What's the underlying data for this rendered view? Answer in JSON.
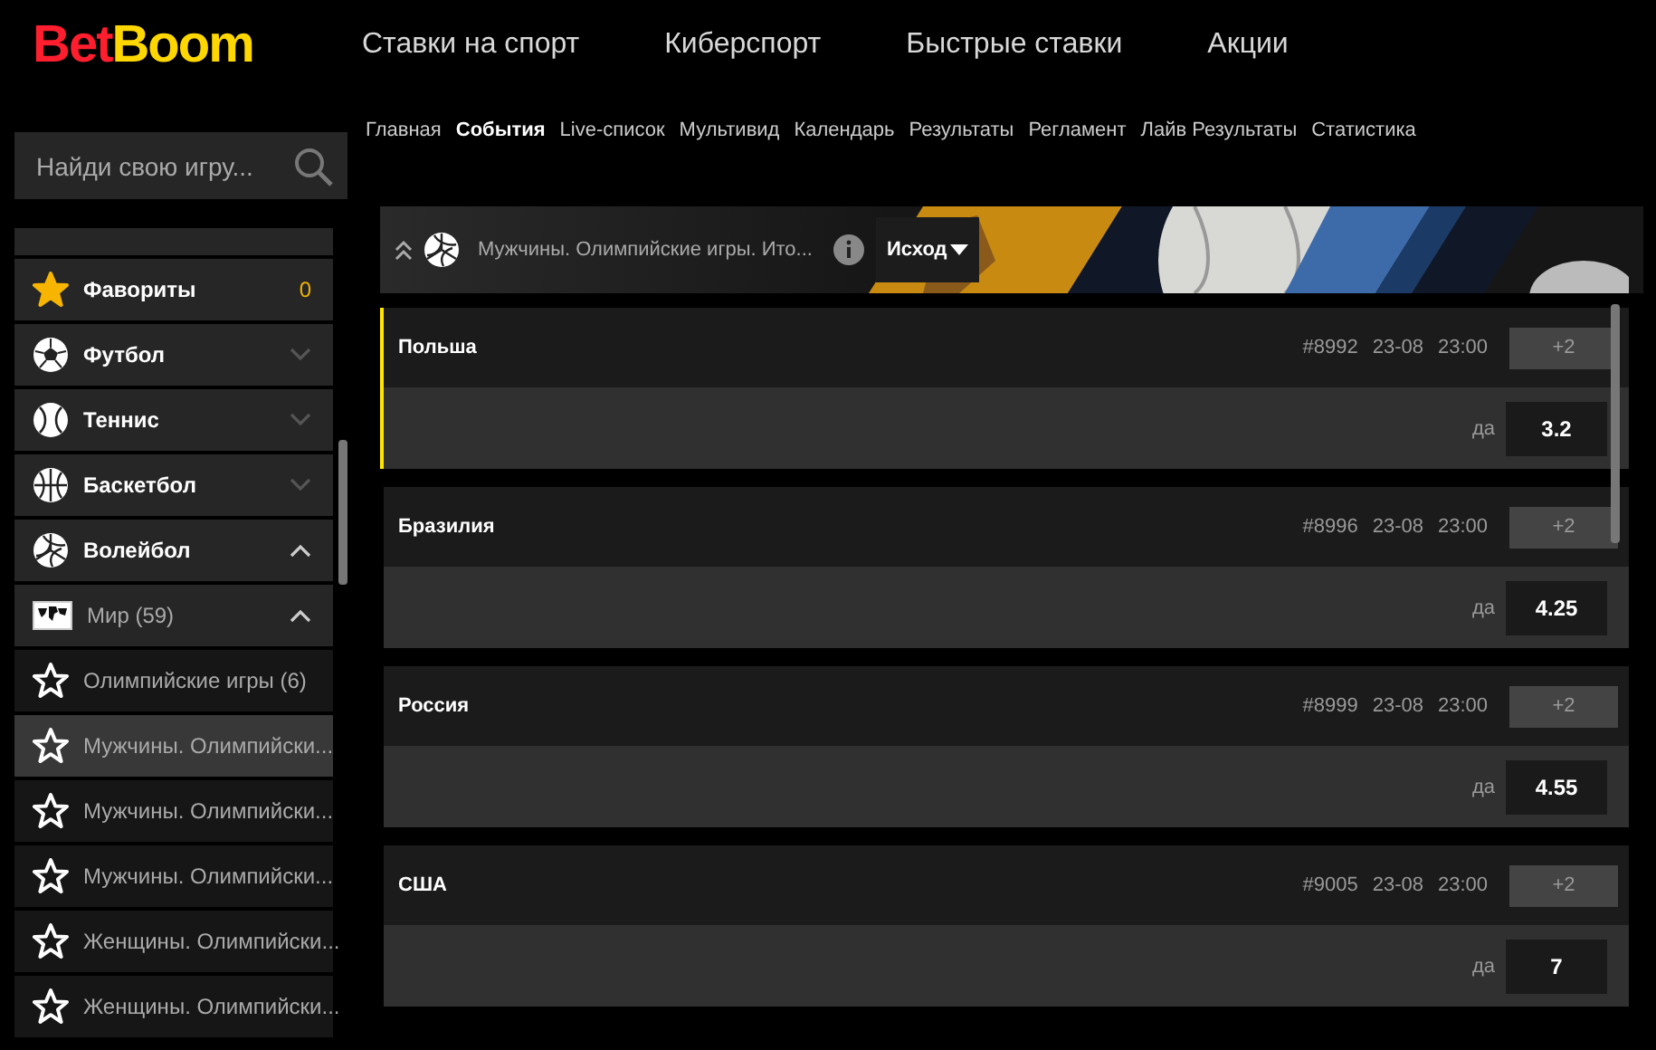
{
  "logo": [
    {
      "text": "Bet",
      "color": "#ff1e2d"
    },
    {
      "text": "Boom",
      "color": "#ffd700"
    }
  ],
  "top_nav": [
    "Ставки на спорт",
    "Киберспорт",
    "Быстрые ставки",
    "Акции"
  ],
  "search": {
    "placeholder": "Найди свою игру..."
  },
  "sub_nav": [
    {
      "label": "Главная",
      "selected": false
    },
    {
      "label": "События",
      "selected": true
    },
    {
      "label": "Live-список",
      "selected": false
    },
    {
      "label": "Мультивид",
      "selected": false
    },
    {
      "label": "Календарь",
      "selected": false
    },
    {
      "label": "Результаты",
      "selected": false
    },
    {
      "label": "Регламент",
      "selected": false
    },
    {
      "label": "Лайв Результаты",
      "selected": false
    },
    {
      "label": "Статистика",
      "selected": false
    }
  ],
  "sidebar": [
    {
      "kind": "favorites",
      "label": "Фавориты",
      "count": "0"
    },
    {
      "kind": "sport",
      "label": "Футбол",
      "expanded": false
    },
    {
      "kind": "sport",
      "label": "Теннис",
      "expanded": false
    },
    {
      "kind": "sport",
      "label": "Баскетбол",
      "expanded": false
    },
    {
      "kind": "sport",
      "label": "Волейбол",
      "expanded": true
    },
    {
      "kind": "region",
      "label": "Мир (59)",
      "expanded": true
    },
    {
      "kind": "league",
      "label": "Олимпийские игры (6)",
      "selected": false
    },
    {
      "kind": "league",
      "label": "Мужчины. Олимпийски...",
      "selected": true
    },
    {
      "kind": "league",
      "label": "Мужчины. Олимпийски...",
      "selected": false
    },
    {
      "kind": "league",
      "label": "Мужчины. Олимпийски...",
      "selected": false
    },
    {
      "kind": "league",
      "label": "Женщины. Олимпийски...",
      "selected": false
    },
    {
      "kind": "league",
      "label": "Женщины. Олимпийски...",
      "selected": false
    }
  ],
  "banner": {
    "title": "Мужчины. Олимпийские игры. Ито...",
    "market": "Исход"
  },
  "events": [
    {
      "team": "Польша",
      "id": "#8992",
      "date": "23-08",
      "time": "23:00",
      "more": "+2",
      "outcome": "да",
      "odds": "3.2",
      "selected": true
    },
    {
      "team": "Бразилия",
      "id": "#8996",
      "date": "23-08",
      "time": "23:00",
      "more": "+2",
      "outcome": "да",
      "odds": "4.25",
      "selected": false
    },
    {
      "team": "Россия",
      "id": "#8999",
      "date": "23-08",
      "time": "23:00",
      "more": "+2",
      "outcome": "да",
      "odds": "4.55",
      "selected": false
    },
    {
      "team": "США",
      "id": "#9005",
      "date": "23-08",
      "time": "23:00",
      "more": "+2",
      "outcome": "да",
      "odds": "7",
      "selected": false
    }
  ]
}
